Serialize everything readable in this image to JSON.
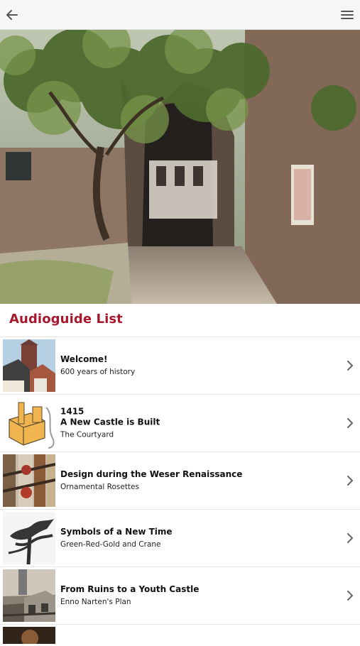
{
  "header": {
    "back_icon": "back-arrow-icon",
    "menu_icon": "hamburger-menu-icon"
  },
  "hero": {
    "image": "castle gate courtyard photo"
  },
  "section": {
    "title": "Audioguide List"
  },
  "items": [
    {
      "title_lines": [
        "Welcome!"
      ],
      "subtitle": "600 years of history",
      "thumbnail": "castle tower photo"
    },
    {
      "title_lines": [
        "1415",
        "A New Castle is Built"
      ],
      "subtitle": "The Courtyard",
      "thumbnail": "castle illustration"
    },
    {
      "title_lines": [
        "Design during the Weser Renaissance"
      ],
      "subtitle": "Ornamental Rosettes",
      "thumbnail": "half-timbered facade photo"
    },
    {
      "title_lines": [
        "Symbols of a New Time"
      ],
      "subtitle": "Green-Red-Gold and Crane",
      "thumbnail": "iron crane sculpture photo"
    },
    {
      "title_lines": [
        "From Ruins to a Youth Castle"
      ],
      "subtitle": "Enno Narten's Plan",
      "thumbnail": "historic castle photo"
    },
    {
      "title_lines": [
        ""
      ],
      "subtitle": "",
      "thumbnail": "partial image"
    }
  ],
  "colors": {
    "accent": "#a8172b",
    "header_bg": "#f6f6f6",
    "divider": "#e7e7e7"
  }
}
